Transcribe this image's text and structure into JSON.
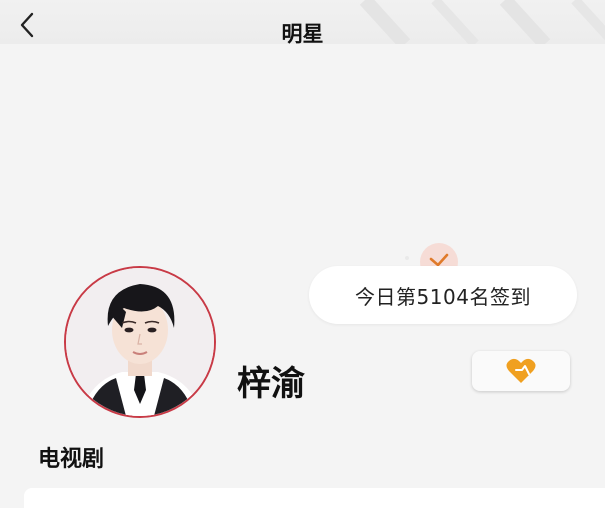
{
  "nav": {
    "title": "明星",
    "back_icon": "chevron-left-icon"
  },
  "checkin": {
    "text": "今日第5104名签到",
    "icon": "check-icon"
  },
  "profile": {
    "name": "梓渝",
    "avatar": "avatar-photo"
  },
  "follow": {
    "icon": "heart-icon"
  },
  "section": {
    "title": "电视剧"
  },
  "colors": {
    "accent": "#f0a020",
    "check": "#e07a2a",
    "ring": "#c83a46"
  }
}
